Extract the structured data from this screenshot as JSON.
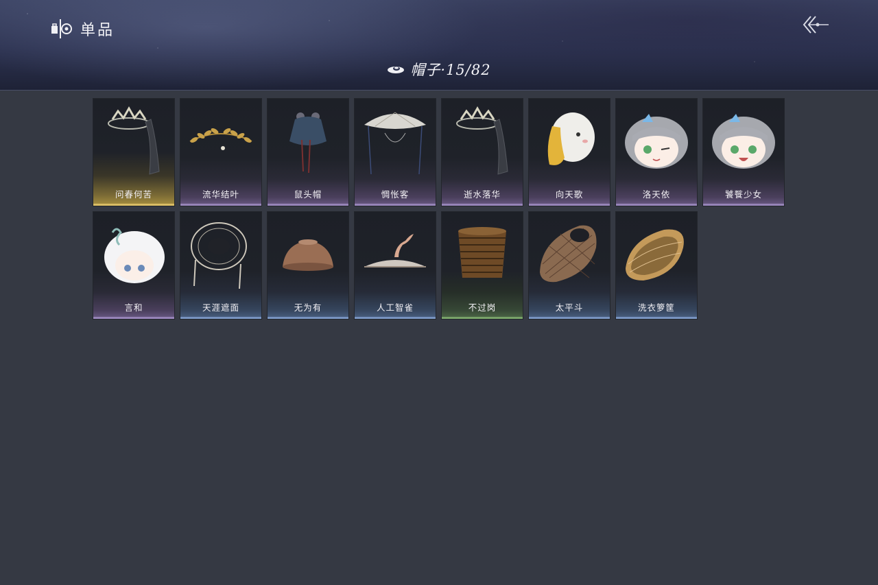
{
  "header": {
    "title": "单品",
    "title_icon": "wardrobe-icon",
    "back_icon": "back-arrow-icon"
  },
  "category": {
    "icon": "hat-icon",
    "label": "帽子·15/82"
  },
  "colors": {
    "background": "#353943",
    "header": "#2c3250",
    "card": "#1f2229",
    "rarity_gold": "#a89040",
    "rarity_purple": "#6b5b86",
    "rarity_blue": "#4c6284",
    "rarity_green": "#4f6a48"
  },
  "items": [
    {
      "name": "问春何苦",
      "rarity": "gold",
      "icon": "bone-crown-veil-icon"
    },
    {
      "name": "流华结叶",
      "rarity": "purple",
      "icon": "golden-laurel-icon"
    },
    {
      "name": "鼠头帽",
      "rarity": "purple",
      "icon": "mouse-hood-icon"
    },
    {
      "name": "惆怅客",
      "rarity": "purple",
      "icon": "veiled-bamboo-hat-icon"
    },
    {
      "name": "逝水落华",
      "rarity": "purple",
      "icon": "bone-crown-veil-icon"
    },
    {
      "name": "向天歌",
      "rarity": "purple",
      "icon": "goose-hat-icon"
    },
    {
      "name": "洛天依",
      "rarity": "purple",
      "icon": "luo-tianyi-head-icon"
    },
    {
      "name": "饕餮少女",
      "rarity": "purple",
      "icon": "luo-tianyi-head-icon"
    },
    {
      "name": "言和",
      "rarity": "purple",
      "icon": "yan-he-head-icon"
    },
    {
      "name": "天涯遮面",
      "rarity": "blue",
      "icon": "broken-bamboo-hat-icon"
    },
    {
      "name": "无为有",
      "rarity": "blue",
      "icon": "clay-bowl-hat-icon"
    },
    {
      "name": "人工智雀",
      "rarity": "blue",
      "icon": "bird-flat-hat-icon"
    },
    {
      "name": "不过岗",
      "rarity": "green",
      "icon": "stacked-bowls-icon"
    },
    {
      "name": "太平斗",
      "rarity": "blue",
      "icon": "woven-basket-icon"
    },
    {
      "name": "洗衣箩筐",
      "rarity": "blue",
      "icon": "laundry-basket-icon"
    }
  ]
}
